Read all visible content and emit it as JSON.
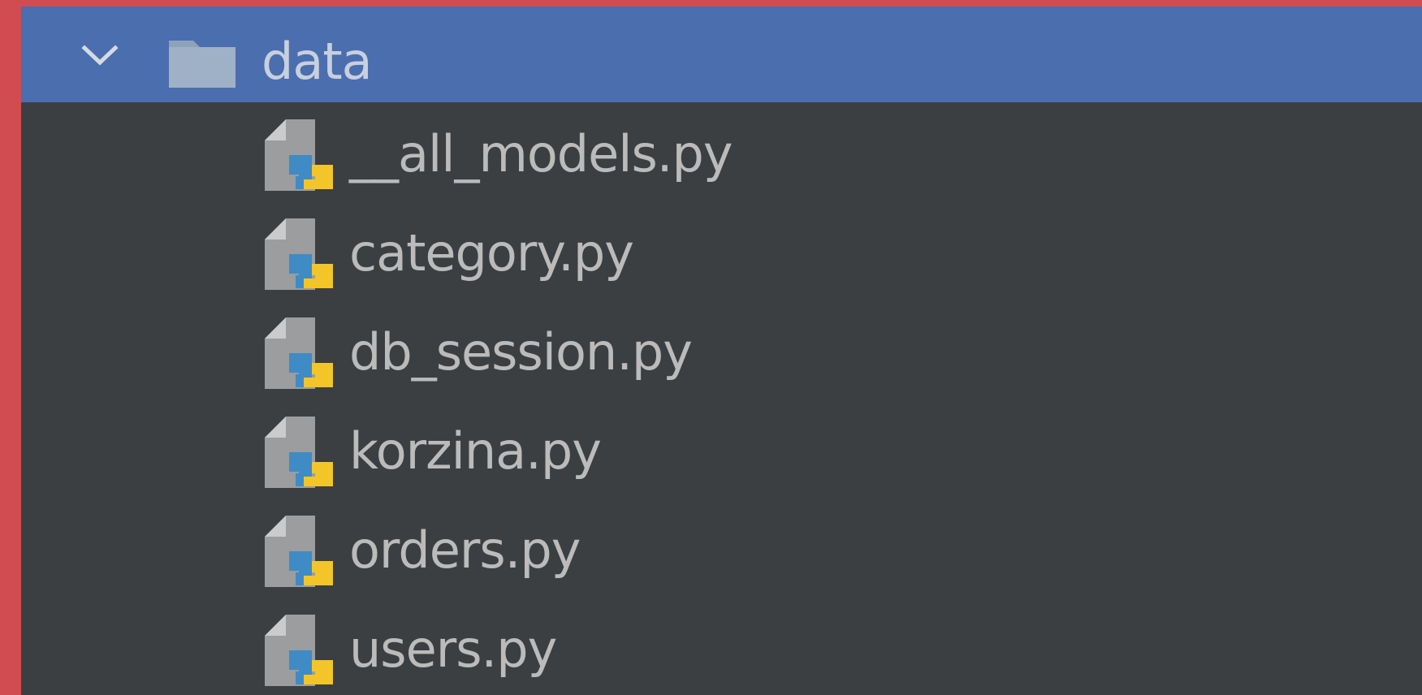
{
  "colors": {
    "window_border": "#d04c51",
    "panel_background": "#3c3f41",
    "selected_row": "#4b6eaf",
    "text": "#bbbbbb",
    "folder_icon": "#8ea3b9",
    "python_blue": "#3f8bc5",
    "python_yellow": "#f2c529"
  },
  "tree": {
    "folder": {
      "label": "data",
      "expanded": true,
      "icons": {
        "toggle": "chevron-down-icon",
        "folder": "folder-icon"
      }
    },
    "files": [
      {
        "label": "__all_models.py",
        "icon": "python-file-icon"
      },
      {
        "label": "category.py",
        "icon": "python-file-icon"
      },
      {
        "label": "db_session.py",
        "icon": "python-file-icon"
      },
      {
        "label": "korzina.py",
        "icon": "python-file-icon"
      },
      {
        "label": "orders.py",
        "icon": "python-file-icon"
      },
      {
        "label": "users.py",
        "icon": "python-file-icon"
      }
    ]
  }
}
